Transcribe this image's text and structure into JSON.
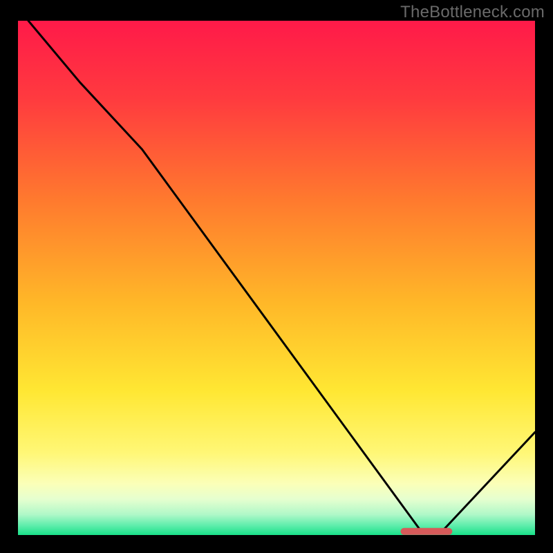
{
  "watermark": "TheBottleneck.com",
  "chart_data": {
    "type": "line",
    "title": "",
    "xlabel": "",
    "ylabel": "",
    "xlim": [
      0,
      100
    ],
    "ylim": [
      0,
      100
    ],
    "grid": false,
    "annotations": [],
    "series": [
      {
        "name": "curve",
        "x": [
          2,
          12,
          24,
          78,
          82,
          100
        ],
        "y": [
          100,
          88,
          75,
          0.7,
          0.7,
          20
        ]
      }
    ],
    "marker": {
      "name": "optimum-segment",
      "x_start": 74,
      "x_end": 84,
      "y": 0.7,
      "color": "#d65a5a"
    },
    "gradient_stops": [
      {
        "offset": 0,
        "color": "#ff1a49"
      },
      {
        "offset": 15,
        "color": "#ff3a3f"
      },
      {
        "offset": 35,
        "color": "#ff7a2e"
      },
      {
        "offset": 55,
        "color": "#ffb828"
      },
      {
        "offset": 72,
        "color": "#ffe733"
      },
      {
        "offset": 84,
        "color": "#fff776"
      },
      {
        "offset": 90,
        "color": "#fbffb8"
      },
      {
        "offset": 93,
        "color": "#e6ffcf"
      },
      {
        "offset": 96,
        "color": "#b0f8c8"
      },
      {
        "offset": 98,
        "color": "#64eeae"
      },
      {
        "offset": 100,
        "color": "#19e189"
      }
    ]
  }
}
